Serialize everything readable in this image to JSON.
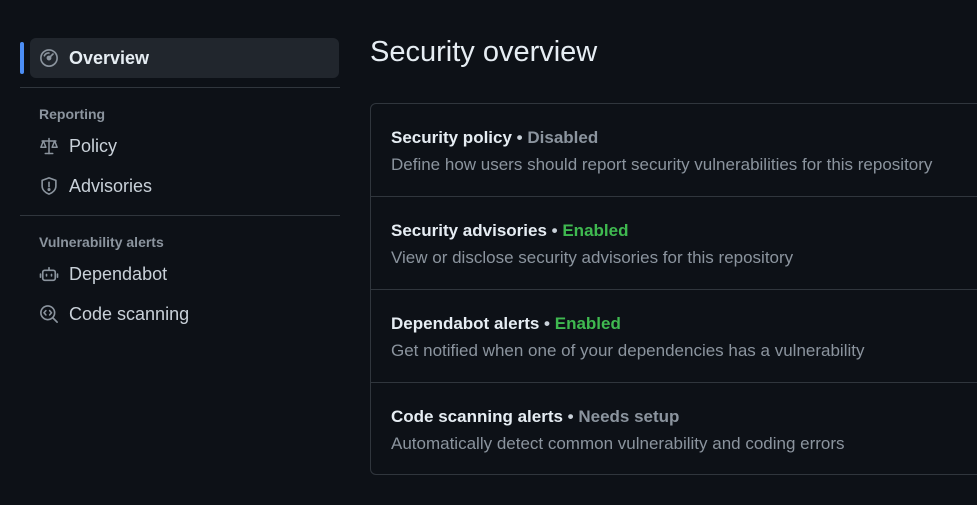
{
  "sidebar": {
    "overview": {
      "label": "Overview",
      "icon": "meter-icon",
      "active": true
    },
    "sections": [
      {
        "heading": "Reporting",
        "items": [
          {
            "label": "Policy",
            "icon": "law-icon"
          },
          {
            "label": "Advisories",
            "icon": "shield-icon"
          }
        ]
      },
      {
        "heading": "Vulnerability alerts",
        "items": [
          {
            "label": "Dependabot",
            "icon": "dependabot-icon"
          },
          {
            "label": "Code scanning",
            "icon": "codescan-icon"
          }
        ]
      }
    ],
    "accent_color": "#4c8ef5"
  },
  "main": {
    "title": "Security overview",
    "rows": [
      {
        "title": "Security policy",
        "status": "Disabled",
        "description": "Define how users should report security vulnerabilities for this repository"
      },
      {
        "title": "Security advisories",
        "status": "Enabled",
        "description": "View or disclose security advisories for this repository"
      },
      {
        "title": "Dependabot alerts",
        "status": "Enabled",
        "description": "Get notified when one of your dependencies has a vulnerability"
      },
      {
        "title": "Code scanning alerts",
        "status": "Needs setup",
        "description": "Automatically detect common vulnerability and coding errors"
      }
    ],
    "bullet": "•",
    "status_colors": {
      "enabled": "#3fb950",
      "disabled": "#8b949e"
    }
  }
}
